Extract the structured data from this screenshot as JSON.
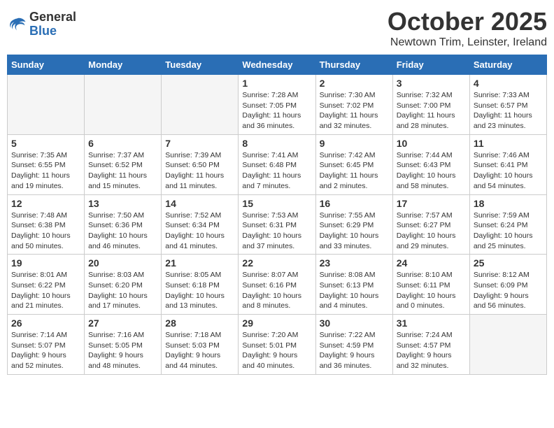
{
  "header": {
    "logo_general": "General",
    "logo_blue": "Blue",
    "month_title": "October 2025",
    "location": "Newtown Trim, Leinster, Ireland"
  },
  "days_of_week": [
    "Sunday",
    "Monday",
    "Tuesday",
    "Wednesday",
    "Thursday",
    "Friday",
    "Saturday"
  ],
  "weeks": [
    [
      {
        "day": null,
        "empty": true
      },
      {
        "day": null,
        "empty": true
      },
      {
        "day": null,
        "empty": true
      },
      {
        "day": "1",
        "sunrise": "7:28 AM",
        "sunset": "7:05 PM",
        "daylight": "11 hours and 36 minutes."
      },
      {
        "day": "2",
        "sunrise": "7:30 AM",
        "sunset": "7:02 PM",
        "daylight": "11 hours and 32 minutes."
      },
      {
        "day": "3",
        "sunrise": "7:32 AM",
        "sunset": "7:00 PM",
        "daylight": "11 hours and 28 minutes."
      },
      {
        "day": "4",
        "sunrise": "7:33 AM",
        "sunset": "6:57 PM",
        "daylight": "11 hours and 23 minutes."
      }
    ],
    [
      {
        "day": "5",
        "sunrise": "7:35 AM",
        "sunset": "6:55 PM",
        "daylight": "11 hours and 19 minutes."
      },
      {
        "day": "6",
        "sunrise": "7:37 AM",
        "sunset": "6:52 PM",
        "daylight": "11 hours and 15 minutes."
      },
      {
        "day": "7",
        "sunrise": "7:39 AM",
        "sunset": "6:50 PM",
        "daylight": "11 hours and 11 minutes."
      },
      {
        "day": "8",
        "sunrise": "7:41 AM",
        "sunset": "6:48 PM",
        "daylight": "11 hours and 7 minutes."
      },
      {
        "day": "9",
        "sunrise": "7:42 AM",
        "sunset": "6:45 PM",
        "daylight": "11 hours and 2 minutes."
      },
      {
        "day": "10",
        "sunrise": "7:44 AM",
        "sunset": "6:43 PM",
        "daylight": "10 hours and 58 minutes."
      },
      {
        "day": "11",
        "sunrise": "7:46 AM",
        "sunset": "6:41 PM",
        "daylight": "10 hours and 54 minutes."
      }
    ],
    [
      {
        "day": "12",
        "sunrise": "7:48 AM",
        "sunset": "6:38 PM",
        "daylight": "10 hours and 50 minutes."
      },
      {
        "day": "13",
        "sunrise": "7:50 AM",
        "sunset": "6:36 PM",
        "daylight": "10 hours and 46 minutes."
      },
      {
        "day": "14",
        "sunrise": "7:52 AM",
        "sunset": "6:34 PM",
        "daylight": "10 hours and 41 minutes."
      },
      {
        "day": "15",
        "sunrise": "7:53 AM",
        "sunset": "6:31 PM",
        "daylight": "10 hours and 37 minutes."
      },
      {
        "day": "16",
        "sunrise": "7:55 AM",
        "sunset": "6:29 PM",
        "daylight": "10 hours and 33 minutes."
      },
      {
        "day": "17",
        "sunrise": "7:57 AM",
        "sunset": "6:27 PM",
        "daylight": "10 hours and 29 minutes."
      },
      {
        "day": "18",
        "sunrise": "7:59 AM",
        "sunset": "6:24 PM",
        "daylight": "10 hours and 25 minutes."
      }
    ],
    [
      {
        "day": "19",
        "sunrise": "8:01 AM",
        "sunset": "6:22 PM",
        "daylight": "10 hours and 21 minutes."
      },
      {
        "day": "20",
        "sunrise": "8:03 AM",
        "sunset": "6:20 PM",
        "daylight": "10 hours and 17 minutes."
      },
      {
        "day": "21",
        "sunrise": "8:05 AM",
        "sunset": "6:18 PM",
        "daylight": "10 hours and 13 minutes."
      },
      {
        "day": "22",
        "sunrise": "8:07 AM",
        "sunset": "6:16 PM",
        "daylight": "10 hours and 8 minutes."
      },
      {
        "day": "23",
        "sunrise": "8:08 AM",
        "sunset": "6:13 PM",
        "daylight": "10 hours and 4 minutes."
      },
      {
        "day": "24",
        "sunrise": "8:10 AM",
        "sunset": "6:11 PM",
        "daylight": "10 hours and 0 minutes."
      },
      {
        "day": "25",
        "sunrise": "8:12 AM",
        "sunset": "6:09 PM",
        "daylight": "9 hours and 56 minutes."
      }
    ],
    [
      {
        "day": "26",
        "sunrise": "7:14 AM",
        "sunset": "5:07 PM",
        "daylight": "9 hours and 52 minutes."
      },
      {
        "day": "27",
        "sunrise": "7:16 AM",
        "sunset": "5:05 PM",
        "daylight": "9 hours and 48 minutes."
      },
      {
        "day": "28",
        "sunrise": "7:18 AM",
        "sunset": "5:03 PM",
        "daylight": "9 hours and 44 minutes."
      },
      {
        "day": "29",
        "sunrise": "7:20 AM",
        "sunset": "5:01 PM",
        "daylight": "9 hours and 40 minutes."
      },
      {
        "day": "30",
        "sunrise": "7:22 AM",
        "sunset": "4:59 PM",
        "daylight": "9 hours and 36 minutes."
      },
      {
        "day": "31",
        "sunrise": "7:24 AM",
        "sunset": "4:57 PM",
        "daylight": "9 hours and 32 minutes."
      },
      {
        "day": null,
        "empty": true
      }
    ]
  ],
  "labels": {
    "sunrise_label": "Sunrise:",
    "sunset_label": "Sunset:",
    "daylight_label": "Daylight:"
  }
}
